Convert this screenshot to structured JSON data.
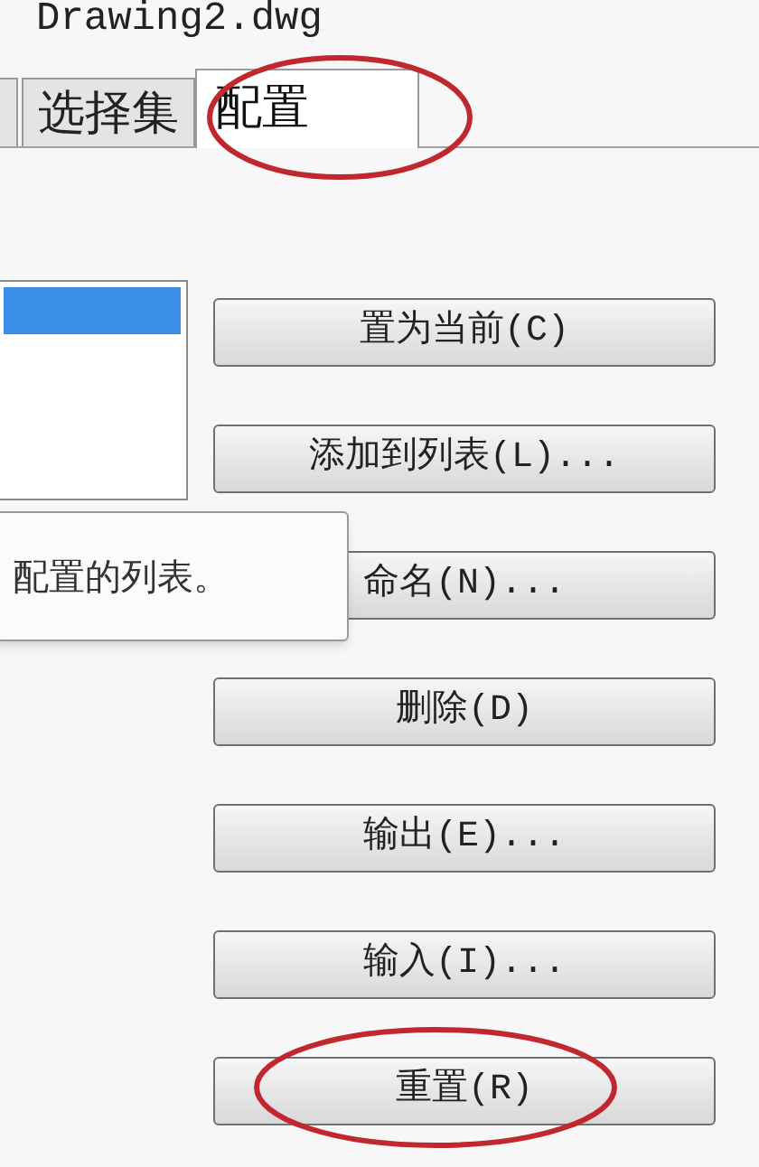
{
  "window": {
    "title": "Drawing2.dwg"
  },
  "tabs": [
    {
      "label": "选择集",
      "selected": false
    },
    {
      "label": "配置",
      "selected": true
    }
  ],
  "profile_list": {
    "rows": [
      {
        "selected": true
      }
    ]
  },
  "tooltip": {
    "text": "配置的列表。"
  },
  "buttons": [
    {
      "label": "置为当前(C)"
    },
    {
      "label": "添加到列表(L)..."
    },
    {
      "label": "命名(N)..."
    },
    {
      "label": "删除(D)"
    },
    {
      "label": "输出(E)..."
    },
    {
      "label": "输入(I)..."
    },
    {
      "label": "重置(R)"
    }
  ]
}
